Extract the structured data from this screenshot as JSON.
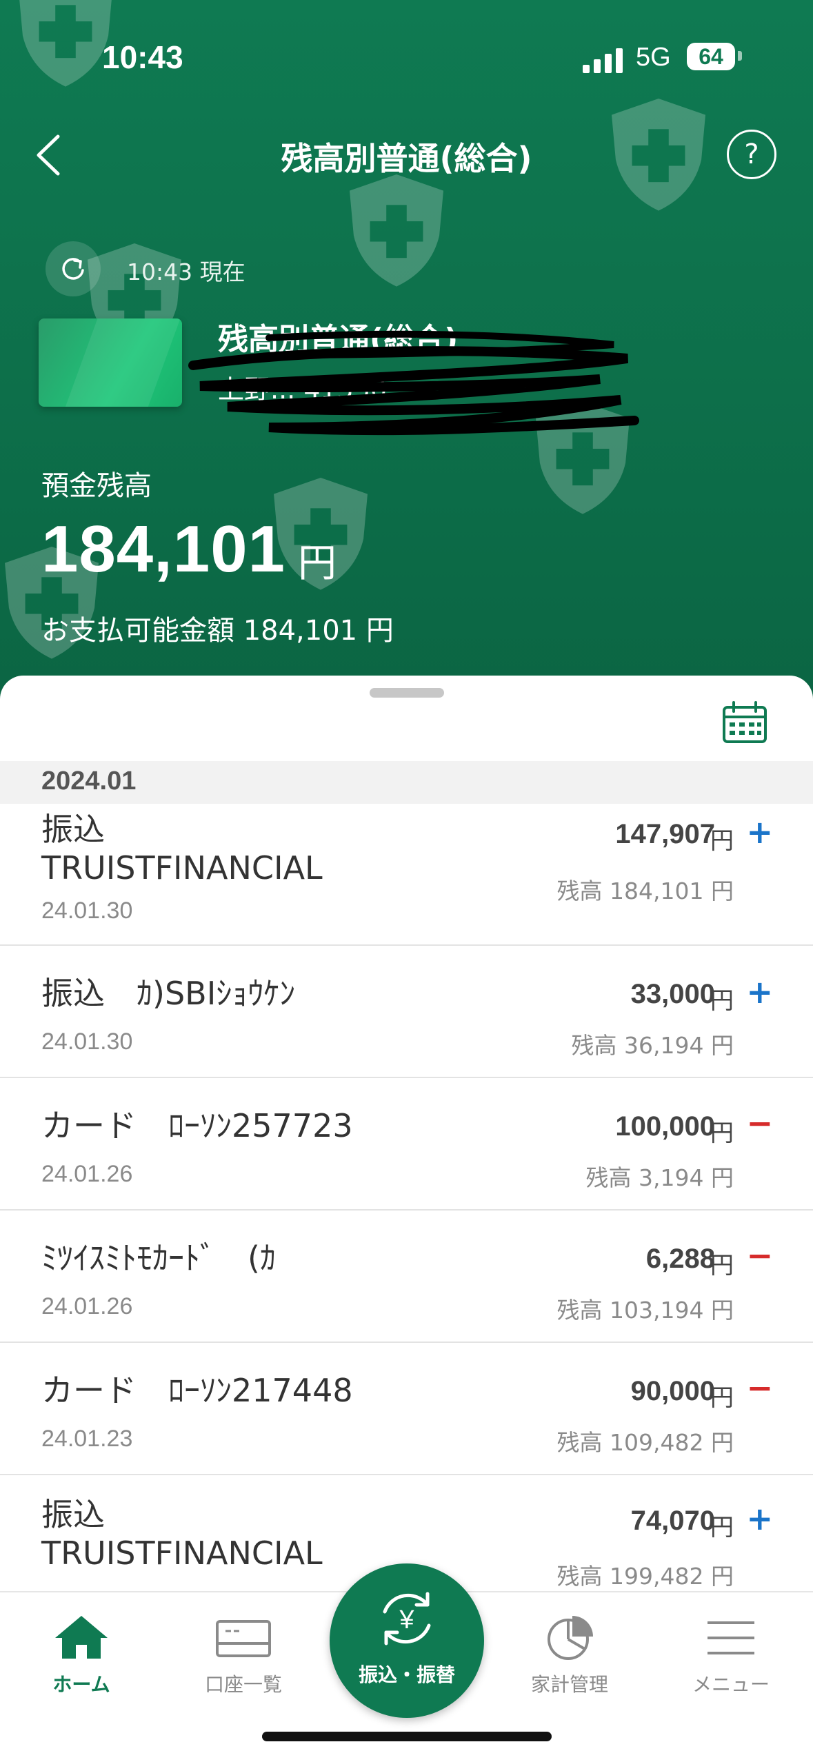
{
  "status_bar": {
    "time": "10:43",
    "network": "5G",
    "battery": "64"
  },
  "nav": {
    "title": "残高別普通(総合)"
  },
  "refresh": {
    "text": "10:43 現在"
  },
  "account": {
    "name": "残高別普通(総合)",
    "number": "上野... 41550"
  },
  "balance": {
    "label": "預金残高",
    "amount": "184,101",
    "currency": "円",
    "available": "お支払可能金額 184,101 円"
  },
  "history": {
    "month": "2024.01",
    "transactions": [
      {
        "desc_line1": "振込",
        "desc_line2": "TRUISTFINANCIAL",
        "date": "24.01.30",
        "amount": "147,907",
        "yen": "円",
        "sign": "+",
        "balance": "残高 184,101 円"
      },
      {
        "desc_line1": "振込　ｶ)SBIｼｮｳｹﾝ",
        "desc_line2": "",
        "date": "24.01.30",
        "amount": "33,000",
        "yen": "円",
        "sign": "+",
        "balance": "残高 36,194 円"
      },
      {
        "desc_line1": "カード　ﾛｰｿﾝ257723",
        "desc_line2": "",
        "date": "24.01.26",
        "amount": "100,000",
        "yen": "円",
        "sign": "−",
        "balance": "残高 3,194 円"
      },
      {
        "desc_line1": "ﾐﾂｲｽﾐﾄﾓｶｰﾄﾞ　(ｶ",
        "desc_line2": "",
        "date": "24.01.26",
        "amount": "6,288",
        "yen": "円",
        "sign": "−",
        "balance": "残高 103,194 円"
      },
      {
        "desc_line1": "カード　ﾛｰｿﾝ217448",
        "desc_line2": "",
        "date": "24.01.23",
        "amount": "90,000",
        "yen": "円",
        "sign": "−",
        "balance": "残高 109,482 円"
      },
      {
        "desc_line1": "振込",
        "desc_line2": "TRUISTFINANCIAL",
        "date": "",
        "amount": "74,070",
        "yen": "円",
        "sign": "+",
        "balance": "残高 199,482 円"
      }
    ]
  },
  "tabbar": {
    "home": "ホーム",
    "accounts": "口座一覧",
    "transfer": "振込・振替",
    "budget": "家計管理",
    "menu": "メニュー"
  },
  "colors": {
    "brand_green": "#0f7a52",
    "plus_blue": "#1a74c9",
    "minus_red": "#d62b2b"
  }
}
